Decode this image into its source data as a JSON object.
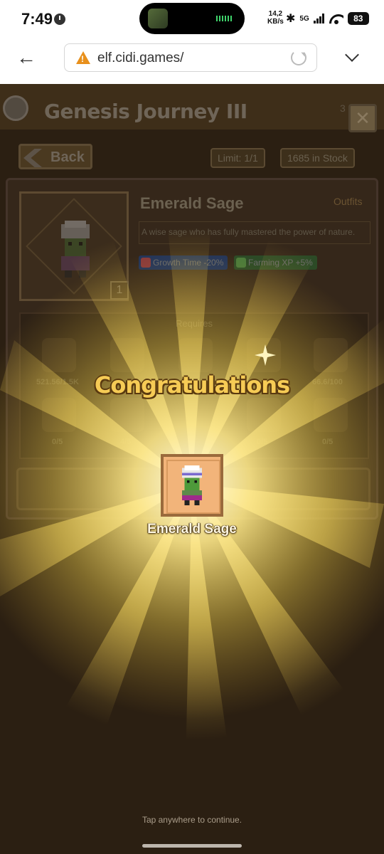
{
  "status_bar": {
    "time": "7:49",
    "net_speed_value": "14,2",
    "net_speed_unit": "KB/s",
    "network": "5G",
    "battery": "83"
  },
  "browser": {
    "url": "elf.cidi.games/"
  },
  "game": {
    "title": "Genesis Journey III",
    "top_counter": "3",
    "back_label": "Back",
    "limit": "Limit: 1/1",
    "stock": "1685 in Stock",
    "item": {
      "name": "Emerald Sage",
      "category": "Outfits",
      "description": "A wise sage who has fully mastered the power of nature.",
      "count": "1",
      "buffs": [
        {
          "label": "Growth Time -20%",
          "color": "#2a4a8a",
          "icon": "strawberry-icon"
        },
        {
          "label": "Farming XP +5%",
          "color": "#2f5a2a",
          "icon": "leaf-icon"
        }
      ]
    },
    "requirements": {
      "title": "Requires",
      "items": [
        {
          "icon": "carrot-icon",
          "count": "521.56/1.5K"
        },
        {
          "icon": "pumpkin-icon",
          "count": ""
        },
        {
          "icon": "egg-icon",
          "count": ""
        },
        {
          "icon": "nut-icon",
          "count": ""
        },
        {
          "icon": "stone-icon",
          "count": "66.6/100"
        },
        {
          "icon": "honey-jar-icon",
          "count": "0/5"
        },
        {
          "icon": "item-icon",
          "count": "4/5"
        },
        {
          "icon": "item-icon",
          "count": ""
        },
        {
          "icon": "item-icon",
          "count": "0/5"
        },
        {
          "icon": "rope-icon",
          "count": "0/5"
        }
      ]
    }
  },
  "reward": {
    "heading": "Congratulations",
    "item_name": "Emerald Sage",
    "hint": "Tap anywhere to continue."
  }
}
